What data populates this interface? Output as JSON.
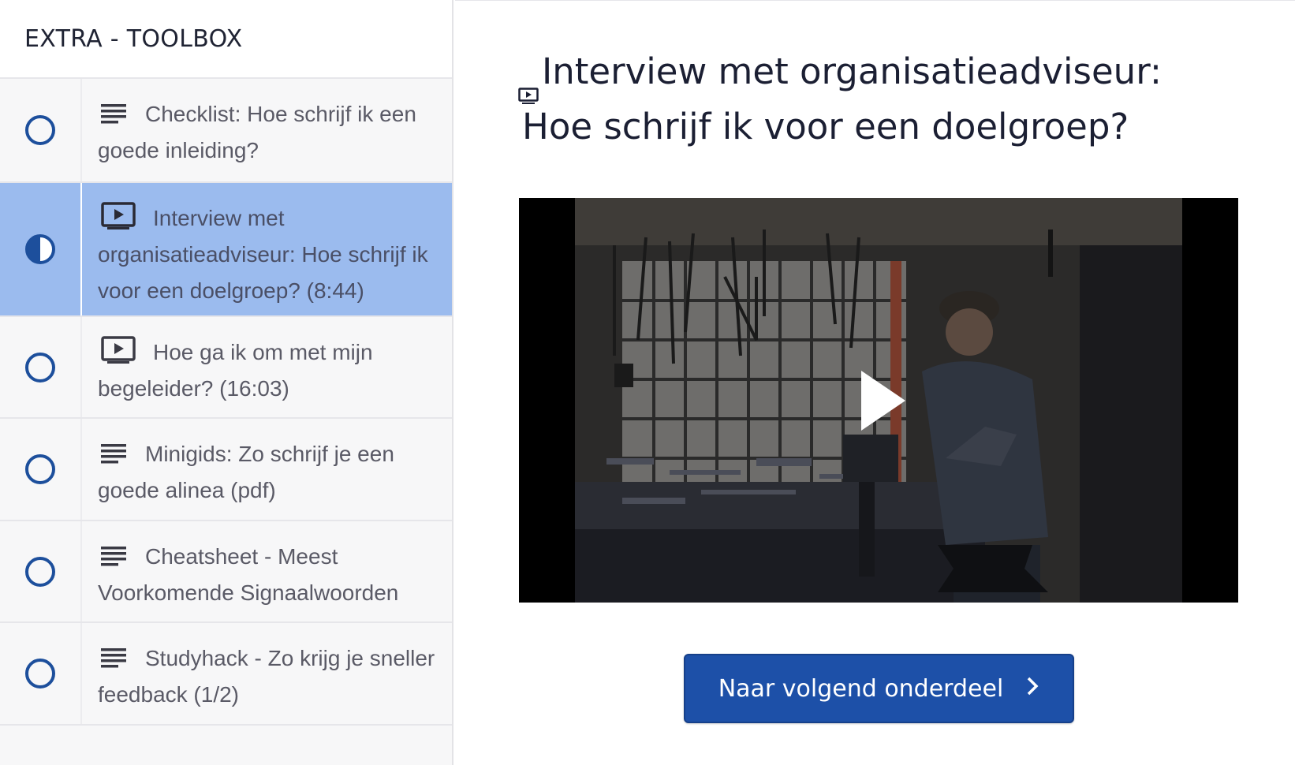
{
  "sidebar": {
    "section_title": "EXTRA - TOOLBOX",
    "items": [
      {
        "type_icon": "text-lines-icon",
        "title": "Checklist: Hoe schrijf ik een goede inleiding?",
        "status": "not-started"
      },
      {
        "type_icon": "video-icon",
        "title": "Interview met organisatieadviseur: Hoe schrijf ik voor een doelgroep? (8:44)",
        "status": "in-progress"
      },
      {
        "type_icon": "video-icon",
        "title": "Hoe ga ik om met mijn begeleider? (16:03)",
        "status": "not-started"
      },
      {
        "type_icon": "text-lines-icon",
        "title": "Minigids: Zo schrijf je een goede alinea (pdf)",
        "status": "not-started"
      },
      {
        "type_icon": "text-lines-icon",
        "title": "Cheatsheet - Meest Voorkomende Signaalwoorden",
        "status": "not-started"
      },
      {
        "type_icon": "text-lines-icon",
        "title": "Studyhack - Zo krijg je sneller feedback (1/2)",
        "status": "not-started"
      }
    ]
  },
  "main": {
    "title_line1": "Interview met organisatieadviseur:",
    "title_line2": "Hoe schrijf ik voor een doelgroep?",
    "title_icon": "video-icon",
    "next_button_label": "Naar volgend onderdeel",
    "next_button_icon": "chevron-right-icon"
  },
  "colors": {
    "accent": "#1d50a8",
    "active_item_bg": "#9bbbee",
    "status_ring": "#1d4f9c"
  }
}
